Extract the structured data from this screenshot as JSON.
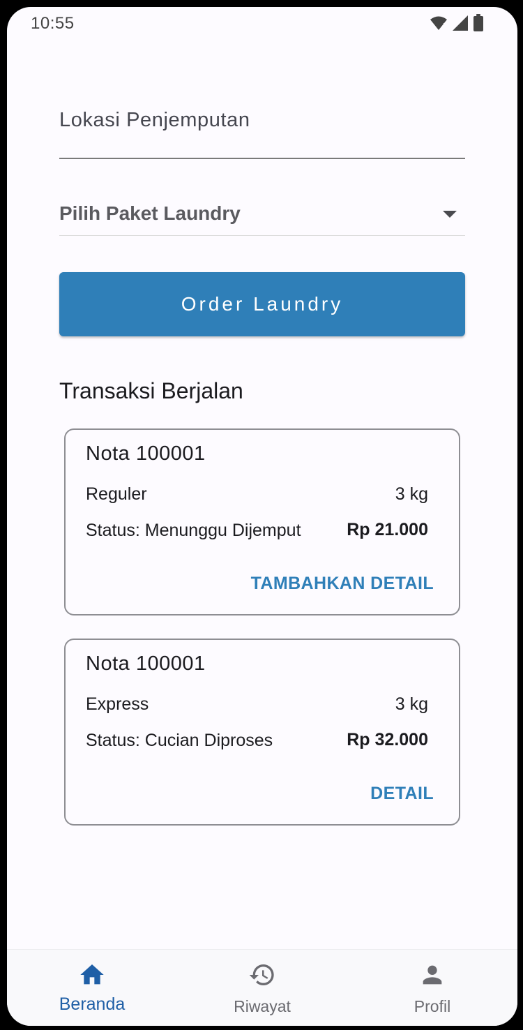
{
  "status_bar": {
    "time": "10:55",
    "icons": [
      "wifi-icon",
      "signal-icon",
      "battery-icon"
    ]
  },
  "form": {
    "pickup_label": "Lokasi Penjemputan",
    "package_label": "Pilih Paket Laundry",
    "order_button": "Order Laundry"
  },
  "transactions": {
    "title": "Transaksi Berjalan",
    "items": [
      {
        "nota": "Nota 100001",
        "package": "Reguler",
        "weight": "3 kg",
        "status": "Status: Menunggu Dijemput",
        "price": "Rp 21.000",
        "action": "TAMBAHKAN DETAIL"
      },
      {
        "nota": "Nota 100001",
        "package": "Express",
        "weight": "3 kg",
        "status": "Status: Cucian Diproses",
        "price": "Rp 32.000",
        "action": "DETAIL"
      }
    ]
  },
  "bottom_nav": {
    "items": [
      {
        "label": "Beranda",
        "icon": "home-icon",
        "active": true
      },
      {
        "label": "Riwayat",
        "icon": "history-icon",
        "active": false
      },
      {
        "label": "Profil",
        "icon": "person-icon",
        "active": false
      }
    ]
  },
  "colors": {
    "primary": "#2f7fb8",
    "nav_active": "#1f5fa6",
    "nav_inactive": "#6b6b70",
    "background": "#fdfbff"
  }
}
